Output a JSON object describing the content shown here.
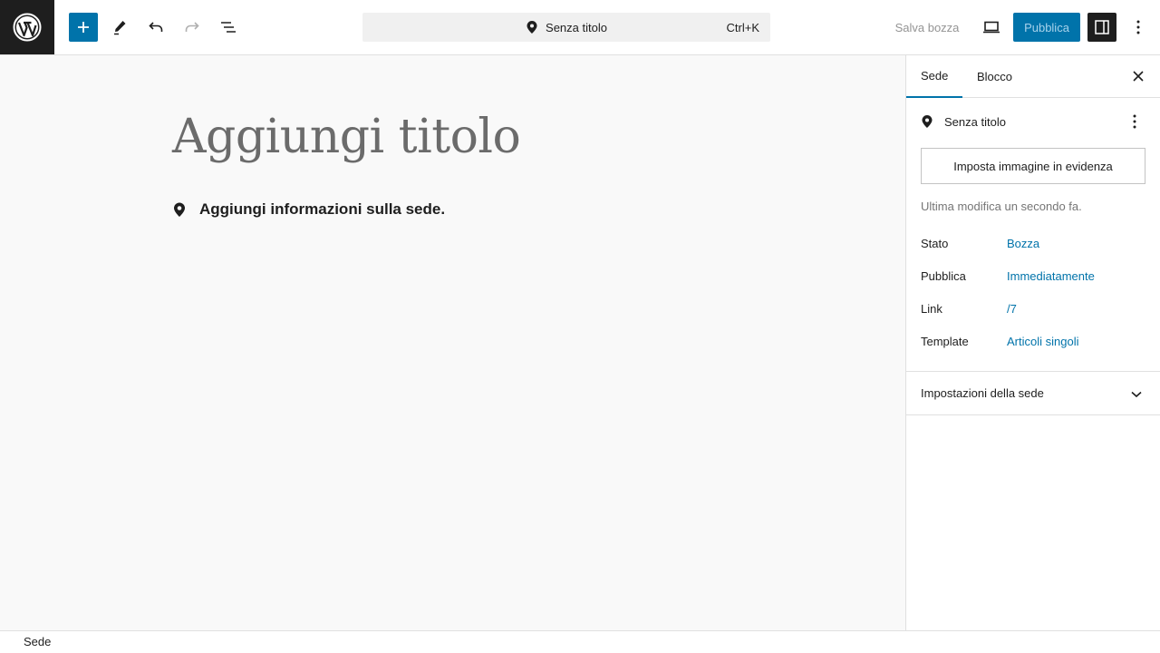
{
  "header": {
    "command_bar": {
      "title": "Senza titolo",
      "shortcut": "Ctrl+K"
    },
    "save_draft_label": "Salva bozza",
    "publish_label": "Pubblica"
  },
  "editor": {
    "title_placeholder": "Aggiungi titolo",
    "place_prompt": "Aggiungi informazioni sulla sede."
  },
  "sidebar": {
    "tabs": [
      {
        "label": "Sede"
      },
      {
        "label": "Blocco"
      }
    ],
    "summary": {
      "title": "Senza titolo",
      "featured_image_label": "Imposta immagine in evidenza",
      "last_modified": "Ultima modifica un secondo fa.",
      "rows": [
        {
          "label": "Stato",
          "value": "Bozza"
        },
        {
          "label": "Pubblica",
          "value": "Immediatamente"
        },
        {
          "label": "Link",
          "value": "/7"
        },
        {
          "label": "Template",
          "value": "Articoli singoli"
        }
      ]
    },
    "settings_panel_label": "Impostazioni della sede"
  },
  "footer": {
    "breadcrumb": "Sede"
  },
  "colors": {
    "accent": "#0073aa",
    "dark": "#1e1e1e",
    "canvas": "#f9f9f9"
  }
}
